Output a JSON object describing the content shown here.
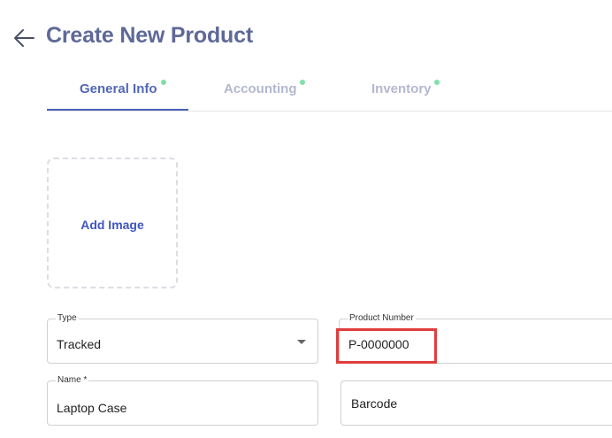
{
  "header": {
    "back_icon": "arrow-left-icon",
    "title": "Create New Product"
  },
  "tabs": [
    {
      "label": "General Info",
      "active": true,
      "status_color": "#7ee0a8"
    },
    {
      "label": "Accounting",
      "active": false,
      "status_color": "#7ee0a8"
    },
    {
      "label": "Inventory",
      "active": false,
      "status_color": "#7ee0a8"
    }
  ],
  "image_upload": {
    "label": "Add Image"
  },
  "form": {
    "type": {
      "label": "Type",
      "value": "Tracked"
    },
    "product_number": {
      "label": "Product Number",
      "value": "P-0000000"
    },
    "name": {
      "label": "Name *",
      "value": "Laptop Case"
    },
    "barcode": {
      "placeholder": "Barcode",
      "value": ""
    }
  },
  "colors": {
    "title": "#5f6997",
    "active_tab": "#5367b6",
    "inactive_tab": "#b3b8cf",
    "status_dot": "#7ee0a8",
    "highlight": "#e03d3d",
    "add_image": "#3f55c4"
  }
}
